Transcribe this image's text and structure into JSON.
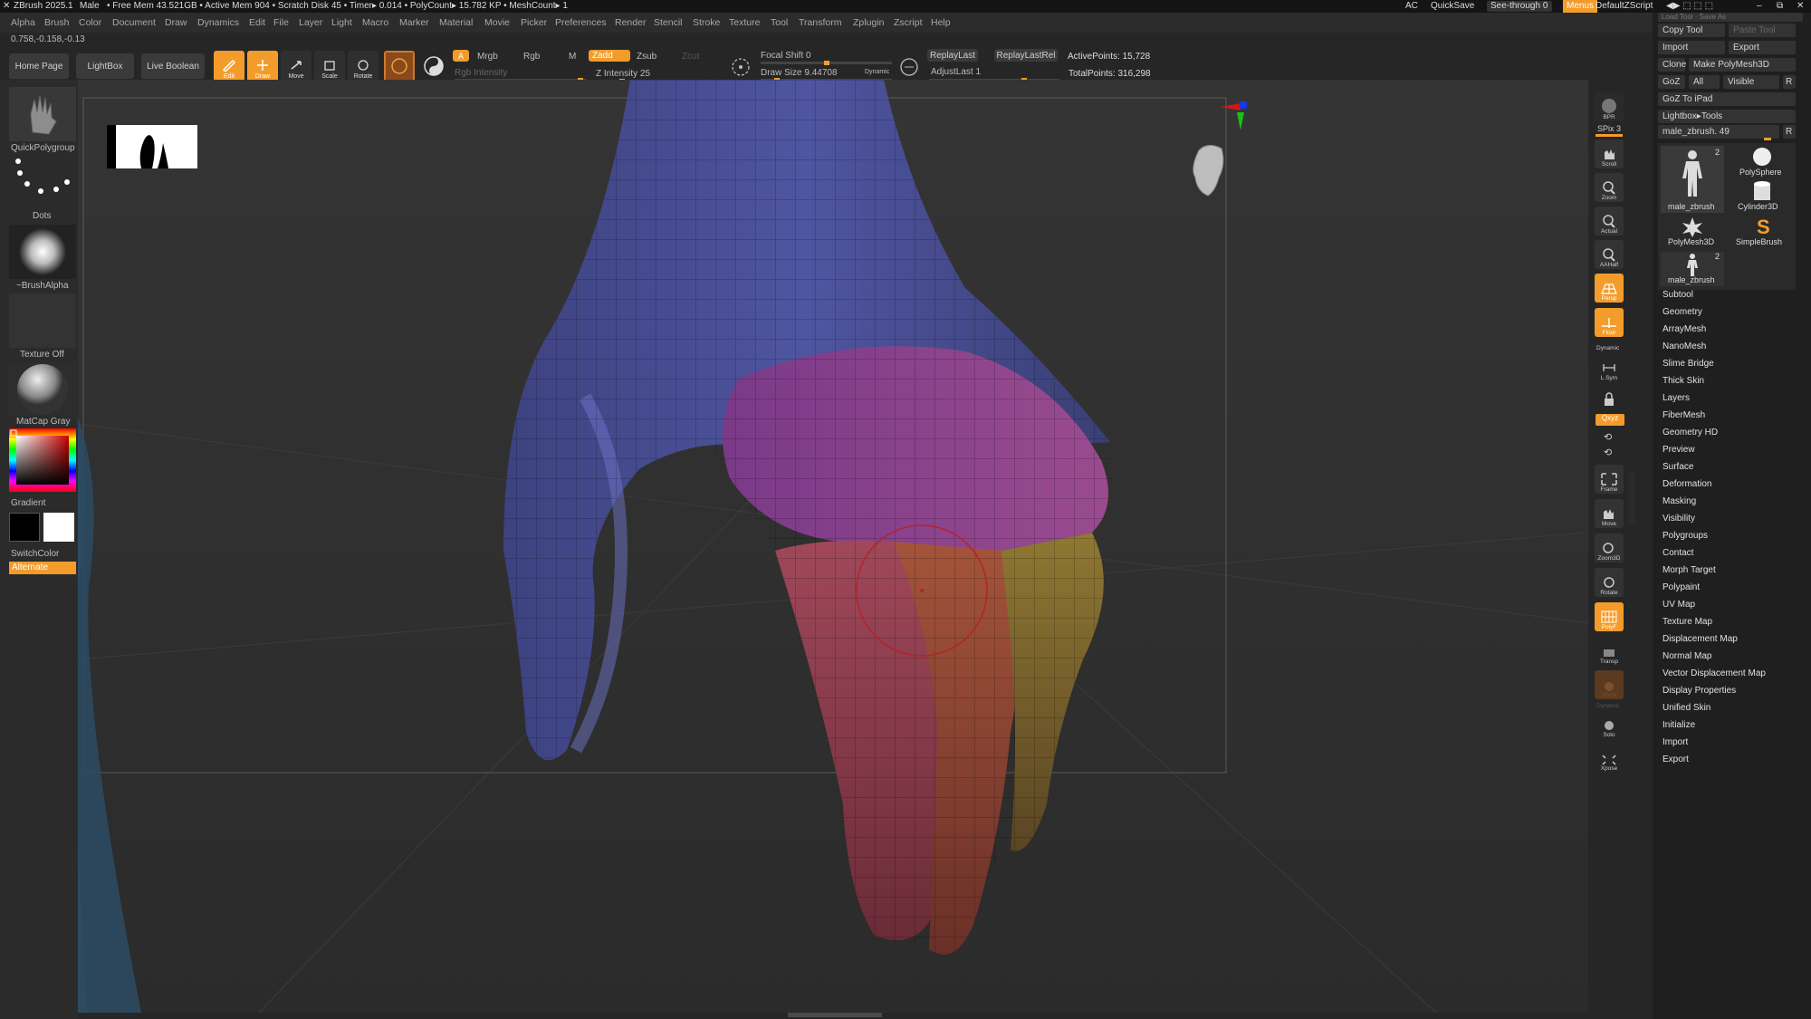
{
  "titlebar": {
    "app": "ZBrush 2025.1",
    "model": "Male",
    "stats": "• Free Mem 43.521GB • Active Mem 904 • Scratch Disk 45 • Timer▸ 0.014 • PolyCount▸ 15.782 KP • MeshCount▸ 1",
    "ac": "AC",
    "quicksave": "QuickSave",
    "seethrough": "See-through",
    "seethrough_value": "0",
    "menus": "Menus",
    "script": "DefaultZScript"
  },
  "menubar": [
    "Alpha",
    "Brush",
    "Color",
    "Document",
    "Draw",
    "Dynamics",
    "Edit",
    "File",
    "Layer",
    "Light",
    "Macro",
    "Marker",
    "Material",
    "Movie",
    "Picker",
    "Preferences",
    "Render",
    "Stencil",
    "Stroke",
    "Texture",
    "Tool",
    "Transform",
    "Zplugin",
    "Zscript",
    "Help"
  ],
  "coords": "0.758,-0.158,-0.13",
  "shelf": {
    "home": "Home Page",
    "lightbox": "LightBox",
    "liveboolean": "Live Boolean",
    "edit": "Edit",
    "draw": "Draw",
    "move": "Move",
    "scale": "Scale",
    "rotate": "Rotate",
    "a": "A",
    "mrgb": "Mrgb",
    "rgb": "Rgb",
    "m": "M",
    "rgb_intensity": "Rgb Intensity",
    "zadd": "Zadd",
    "zsub": "Zsub",
    "zcut": "Zcut",
    "z_intensity_label": "Z Intensity",
    "z_intensity_value": "25",
    "z_intensity_level": 0.25,
    "focal_label": "Focal Shift",
    "focal_value": "0",
    "drawsize_label": "Draw Size",
    "drawsize_value": "9.44708",
    "dynamic": "Dynamic",
    "replaylast": "ReplayLast",
    "replaylastrel": "ReplayLastRel",
    "adjustlast_label": "AdjustLast",
    "adjustlast_value": "1",
    "activepoints": "ActivePoints: 15,728",
    "totalpoints": "TotalPoints: 316,298"
  },
  "lefttray": {
    "brush": "QuickPolygroup",
    "stroke": "Dots",
    "alpha": "~BrushAlpha",
    "texture": "Texture Off",
    "material": "MatCap Gray",
    "gradient": "Gradient",
    "switchcolor": "SwitchColor",
    "alternate": "Alternate"
  },
  "rightshelf": {
    "bpr": "BPR",
    "spix_label": "SPix",
    "spix_value": "3",
    "scroll": "Scroll",
    "zoom": "Zoom",
    "actual": "Actual",
    "aahalf": "AAHalf",
    "persp": "Persp",
    "floor": "Floor",
    "dynamic": "Dynamic",
    "lsym": "L.Sym",
    "qxyz": "Qxyz",
    "frame": "Frame",
    "move": "Move",
    "zoom3d": "Zoom3D",
    "rotate": "Rotate",
    "polyf": "PolyF",
    "transp": "Transp",
    "ghost": "Ghost",
    "solo": "Solo",
    "xpose": "Xpose"
  },
  "toolpanel": {
    "load_tool": "Load Tool",
    "save_as": "Save As",
    "copy_tool": "Copy Tool",
    "paste_tool": "Paste Tool",
    "import": "Import",
    "export": "Export",
    "clone": "Clone",
    "make_polymesh": "Make PolyMesh3D",
    "goz": "GoZ",
    "all": "All",
    "visible": "Visible",
    "r": "R",
    "goz_ipad": "GoZ To iPad",
    "lightbox_tools": "Lightbox▸Tools",
    "current_tool": "male_zbrush. 49",
    "thumbs": [
      {
        "label": "male_zbrush",
        "badge": "2"
      },
      {
        "label": "PolySphere",
        "badge": ""
      },
      {
        "label": "Cylinder3D",
        "badge": ""
      },
      {
        "label": "PolyMesh3D",
        "badge": ""
      },
      {
        "label": "SimpleBrush",
        "badge": ""
      },
      {
        "label": "male_zbrush",
        "badge": "2"
      }
    ]
  },
  "toolmenu": [
    "Subtool",
    "Geometry",
    "ArrayMesh",
    "NanoMesh",
    "Slime Bridge",
    "Thick Skin",
    "Layers",
    "FiberMesh",
    "Geometry HD",
    "Preview",
    "Surface",
    "Deformation",
    "Masking",
    "Visibility",
    "Polygroups",
    "Contact",
    "Morph Target",
    "Polypaint",
    "UV Map",
    "Texture Map",
    "Displacement Map",
    "Normal Map",
    "Vector Displacement Map",
    "Display Properties",
    "Unified Skin",
    "Initialize",
    "Import",
    "Export"
  ],
  "colors": {
    "accent": "#f39c2b",
    "group_blue": "#4a4f93",
    "group_magenta": "#8a3c8a",
    "group_red": "#7a3440",
    "group_orange": "#a3543a",
    "group_yellow": "#8a7530"
  }
}
